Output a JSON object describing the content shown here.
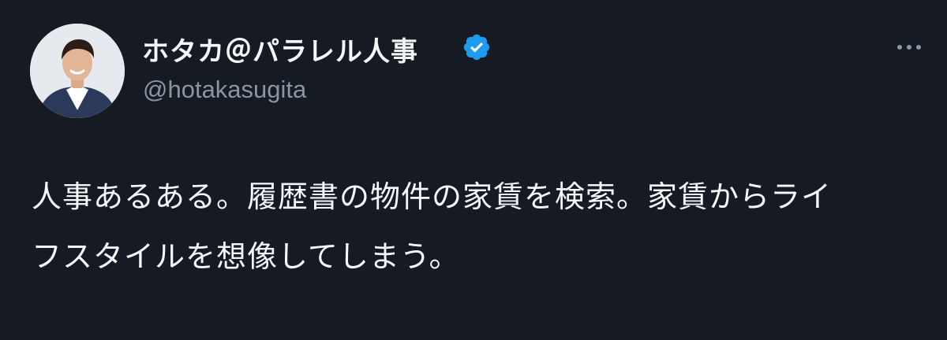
{
  "author": {
    "display_name": "ホタカ＠パラレル人事",
    "handle": "@hotakasugita",
    "verified": true
  },
  "tweet": {
    "text_lines": [
      "人事あるある。履歴書の物件の家賃を検索。家賃からライ",
      "フスタイルを想像してしまう。"
    ]
  },
  "icons": {
    "verified": "verified-badge-icon",
    "more": "more-dots-icon"
  },
  "colors": {
    "background": "#151a23",
    "text": "#f5f7fa",
    "secondary_text": "#8b96a5",
    "verified_blue": "#1d9bf0"
  }
}
